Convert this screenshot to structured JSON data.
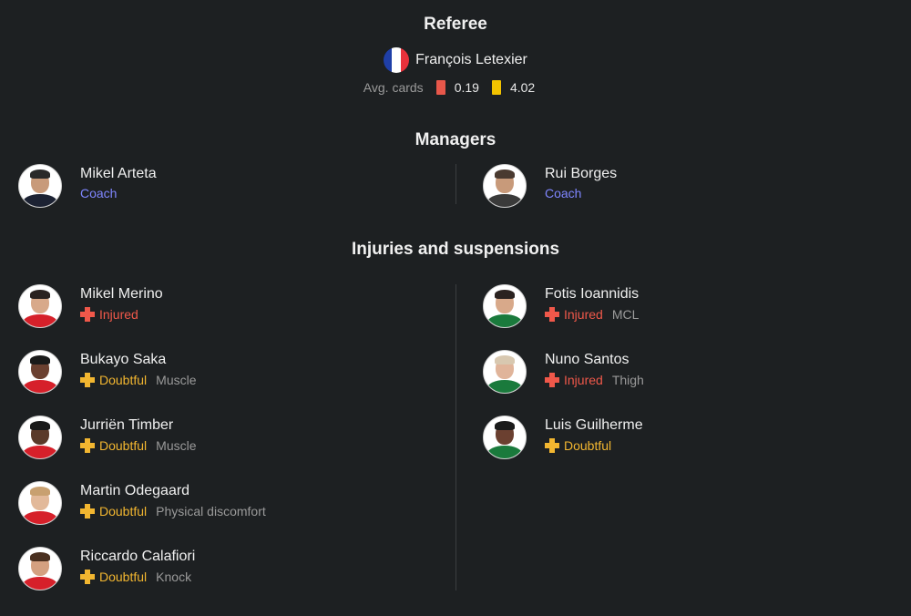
{
  "referee": {
    "title": "Referee",
    "name": "François Letexier",
    "flag_colors": [
      "#1f3fa8",
      "#ffffff",
      "#e8313b"
    ],
    "avg_cards_label": "Avg. cards",
    "red_cards": "0.19",
    "yellow_cards": "4.02",
    "red_color": "#e7574a",
    "yellow_color": "#f2c300"
  },
  "managers": {
    "title": "Managers",
    "home": {
      "name": "Mikel Arteta",
      "role": "Coach"
    },
    "away": {
      "name": "Rui Borges",
      "role": "Coach"
    }
  },
  "injuries": {
    "title": "Injuries and suspensions",
    "home": [
      {
        "name": "Mikel Merino",
        "status": "Injured",
        "detail": ""
      },
      {
        "name": "Bukayo Saka",
        "status": "Doubtful",
        "detail": "Muscle"
      },
      {
        "name": "Jurriën Timber",
        "status": "Doubtful",
        "detail": "Muscle"
      },
      {
        "name": "Martin Odegaard",
        "status": "Doubtful",
        "detail": "Physical discomfort"
      },
      {
        "name": "Riccardo Calafiori",
        "status": "Doubtful",
        "detail": "Knock"
      }
    ],
    "away": [
      {
        "name": "Fotis Ioannidis",
        "status": "Injured",
        "detail": "MCL"
      },
      {
        "name": "Nuno Santos",
        "status": "Injured",
        "detail": "Thigh"
      },
      {
        "name": "Luis Guilherme",
        "status": "Doubtful",
        "detail": ""
      }
    ]
  },
  "colors": {
    "injured": "#f0584a",
    "doubtful": "#f2b630",
    "coach": "#7f86ff",
    "home_kit": "#d6202a",
    "away_kit": "#1a7a3c"
  }
}
